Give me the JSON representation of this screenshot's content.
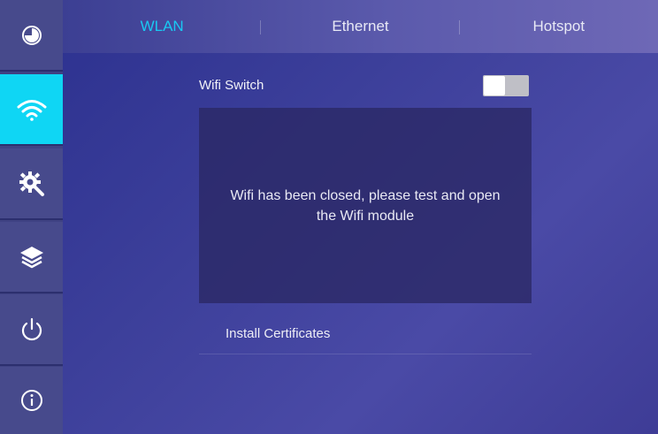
{
  "sidebar": {
    "items": [
      {
        "icon": "pie-chart-icon",
        "active": false
      },
      {
        "icon": "wifi-icon",
        "active": true
      },
      {
        "icon": "settings-icon",
        "active": false
      },
      {
        "icon": "layers-icon",
        "active": false
      },
      {
        "icon": "power-icon",
        "active": false
      },
      {
        "icon": "info-icon",
        "active": false
      }
    ],
    "active_color": "#0fd6f4"
  },
  "tabs": [
    {
      "label": "WLAN",
      "active": true
    },
    {
      "label": "Ethernet",
      "active": false
    },
    {
      "label": "Hotspot",
      "active": false
    }
  ],
  "wlan": {
    "switch_label": "Wifi Switch",
    "switch_on": false,
    "message": "Wifi has been closed, please test and open the Wifi module",
    "install_certificates": "Install Certificates"
  },
  "colors": {
    "accent": "#19c9f2",
    "background": "#3c3f9a"
  }
}
